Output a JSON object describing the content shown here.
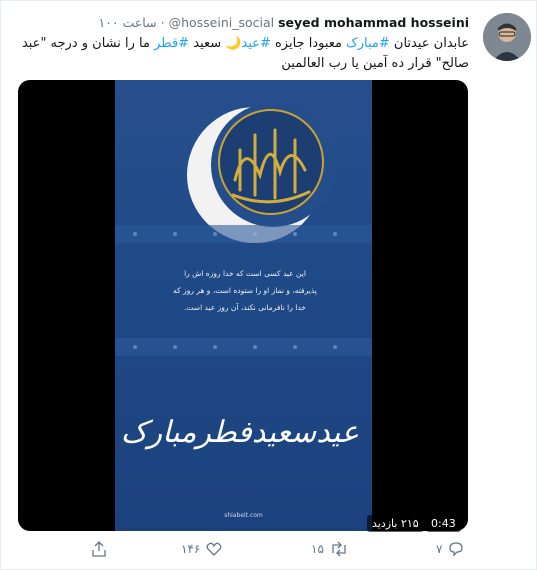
{
  "tweet": {
    "name": "seyed mohammad hosseini",
    "handle": "@hosseini_social",
    "separator": "·",
    "time": "۱۰۰ ساعت",
    "text_parts": [
      {
        "t": "عابدان عیدتان ",
        "tag": false
      },
      {
        "t": "#مبارک",
        "tag": true
      },
      {
        "t": " معبودا جایزه ",
        "tag": false
      },
      {
        "t": "#عید",
        "tag": true
      },
      {
        "t": "🌙 سعید ",
        "tag": false
      },
      {
        "t": "#قطر",
        "tag": true
      },
      {
        "t": " ما را نشان و درجه \"عبد صالح\" قرار ده    آمین یا رب العالمین",
        "tag": false
      }
    ]
  },
  "video": {
    "duration": "0:43",
    "views": "۲۱۵ بازدید",
    "poster_text_lines": [
      "این عید کسی است که خدا روزه اش را",
      "پذیرفته، و نماز او را ستوده است، و هر روز که",
      "خدا را نافرمانی نکند، آن روز عید است."
    ],
    "calligraphy": "عیدسعیدفطرمبارک",
    "watermark": "shiabeit.com"
  },
  "actions": {
    "reply_count": "۷",
    "retweet_count": "۱۵",
    "like_count": "۱۴۶",
    "share_label": ""
  },
  "colors": {
    "accent": "#1da1f2",
    "muted": "#657786"
  }
}
